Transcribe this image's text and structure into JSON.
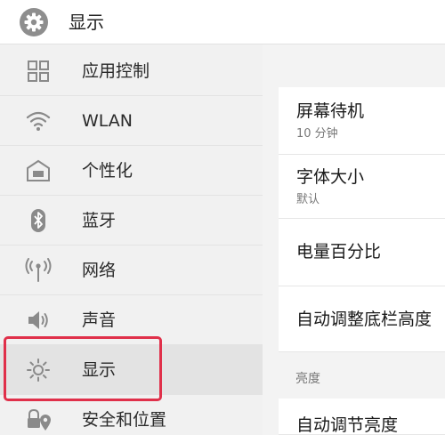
{
  "header": {
    "title": "显示",
    "icon": "gear-icon"
  },
  "sidebar": {
    "items": [
      {
        "label": "应用控制",
        "icon": "app-grid-icon"
      },
      {
        "label": "WLAN",
        "icon": "wifi-icon"
      },
      {
        "label": "个性化",
        "icon": "personalize-icon"
      },
      {
        "label": "蓝牙",
        "icon": "bluetooth-icon"
      },
      {
        "label": "网络",
        "icon": "network-antenna-icon"
      },
      {
        "label": "声音",
        "icon": "speaker-icon"
      },
      {
        "label": "显示",
        "icon": "brightness-icon",
        "active": true
      },
      {
        "label": "安全和位置",
        "icon": "lock-location-icon"
      }
    ]
  },
  "main": {
    "settings": [
      {
        "title": "屏幕待机",
        "subtitle": "10 分钟"
      },
      {
        "title": "字体大小",
        "subtitle": "默认"
      },
      {
        "title": "电量百分比"
      },
      {
        "title": "自动调整底栏高度"
      }
    ],
    "section_label": "亮度",
    "brightness_item": {
      "title": "自动调节亮度"
    }
  },
  "colors": {
    "highlight": "#e0304a",
    "icon_gray": "#8a8a8a"
  }
}
